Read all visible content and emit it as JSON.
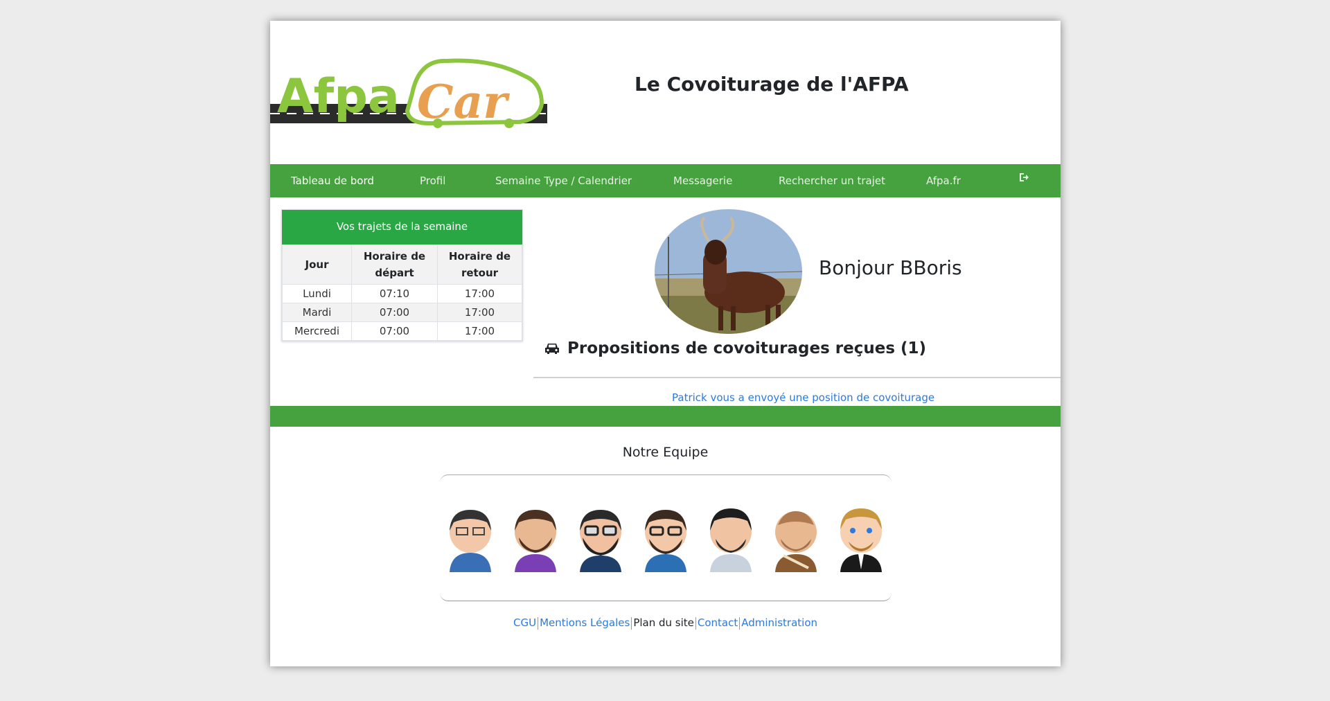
{
  "header": {
    "logo_text_1": "Afpa",
    "logo_text_2": "Car",
    "title": "Le Covoiturage de l'AFPA"
  },
  "nav": {
    "items": [
      {
        "label": "Tableau de bord",
        "active": true
      },
      {
        "label": "Profil"
      },
      {
        "label": "Semaine Type / Calendrier"
      },
      {
        "label": "Messagerie"
      },
      {
        "label": "Rechercher un trajet"
      },
      {
        "label": "Afpa.fr"
      }
    ],
    "logout_icon": "sign-out-icon"
  },
  "week_trips": {
    "title": "Vos trajets de la semaine",
    "headers": [
      "Jour",
      "Horaire de départ",
      "Horaire de retour"
    ],
    "rows": [
      [
        "Lundi",
        "07:10",
        "17:00"
      ],
      [
        "Mardi",
        "07:00",
        "17:00"
      ],
      [
        "Mercredi",
        "07:00",
        "17:00"
      ]
    ]
  },
  "user": {
    "greeting": "Bonjour BBoris",
    "avatar_icon": "goat-photo"
  },
  "proposals": {
    "title": "Propositions de covoiturages reçues (1)",
    "icon": "car-icon",
    "items": [
      "Patrick vous a envoyé une position de covoiturage"
    ]
  },
  "team": {
    "title": "Notre Equipe",
    "members": [
      "member-1",
      "member-2",
      "member-3",
      "member-4",
      "member-5",
      "member-6",
      "member-7"
    ]
  },
  "footer": {
    "links": [
      "CGU",
      "Mentions Légales",
      "Plan du site",
      "Contact",
      "Administration"
    ]
  },
  "colors": {
    "nav_green": "#46a23f",
    "card_header_green": "#2aa745",
    "link_blue": "#2a7ae2",
    "logo_green": "#8cc63f",
    "logo_orange": "#e8a050"
  }
}
